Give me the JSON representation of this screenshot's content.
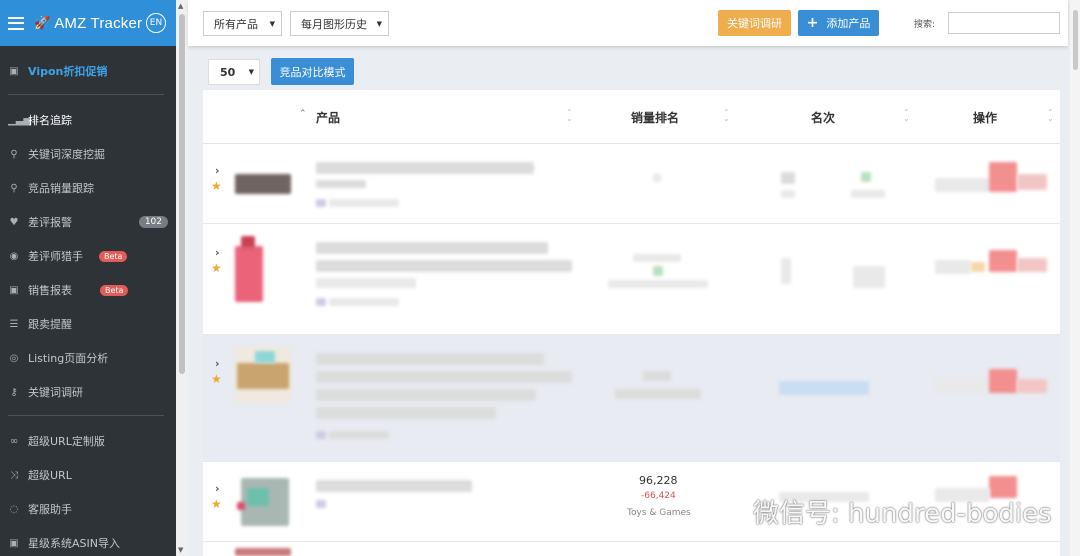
{
  "brand": {
    "title": "AMZ Tracker",
    "lang_badge": "EN",
    "icon": "rocket-icon"
  },
  "sidebar": {
    "promo": {
      "label": "Vipon折扣促销",
      "icon": "gift-icon"
    },
    "items": [
      {
        "label": "排名追踪",
        "icon": "signal-bars-icon"
      },
      {
        "label": "关键词深度挖掘",
        "icon": "search-icon"
      },
      {
        "label": "竞品销量跟踪",
        "icon": "search-icon"
      },
      {
        "label": "差评报警",
        "icon": "heart-icon",
        "count": "102"
      },
      {
        "label": "差评师猎手",
        "icon": "target-icon",
        "badge": "Beta"
      },
      {
        "label": "销售报表",
        "icon": "gift-icon",
        "badge": "Beta"
      },
      {
        "label": "跟卖提醒",
        "icon": "list-icon"
      },
      {
        "label": "Listing页面分析",
        "icon": "eye-icon"
      },
      {
        "label": "关键词调研",
        "icon": "key-icon"
      },
      {
        "label": "超级URL定制版",
        "icon": "link-icon"
      },
      {
        "label": "超级URL",
        "icon": "shuffle-icon"
      },
      {
        "label": "客服助手",
        "icon": "chat-icon"
      },
      {
        "label": "星级系统ASIN导入",
        "icon": "gift-icon"
      }
    ]
  },
  "topbar": {
    "filter_products": "所有产品",
    "history": "每月图形历史",
    "keyword_research_btn": "关键词调研",
    "add_product_btn": "添加产品",
    "search_label": "搜索:",
    "search_value": ""
  },
  "toolbar": {
    "page_size": "50",
    "compare_mode_btn": "竞品对比模式"
  },
  "table": {
    "headers": {
      "product": "产品",
      "sales_rank": "销量排名",
      "position": "名次",
      "actions": "操作"
    },
    "rows": [
      {
        "rank": "",
        "change": "",
        "category": ""
      },
      {
        "rank": "",
        "change": "",
        "category": ""
      },
      {
        "rank": "",
        "change": "",
        "category": ""
      },
      {
        "rank": "96,228",
        "change": "-66,424",
        "category": "Toys & Games"
      }
    ]
  },
  "watermark": {
    "text": "微信号: hundred-bodies",
    "icon": "wechat-icon"
  },
  "colors": {
    "sidebar_bg": "#2e3338",
    "brand_bg": "#2f8fd8",
    "orange_btn": "#f0ad4e",
    "blue_btn": "#3a8ed6",
    "highlight_row": "#e8ebf1",
    "star": "#f0a830",
    "rank_change": "#d9534f"
  }
}
